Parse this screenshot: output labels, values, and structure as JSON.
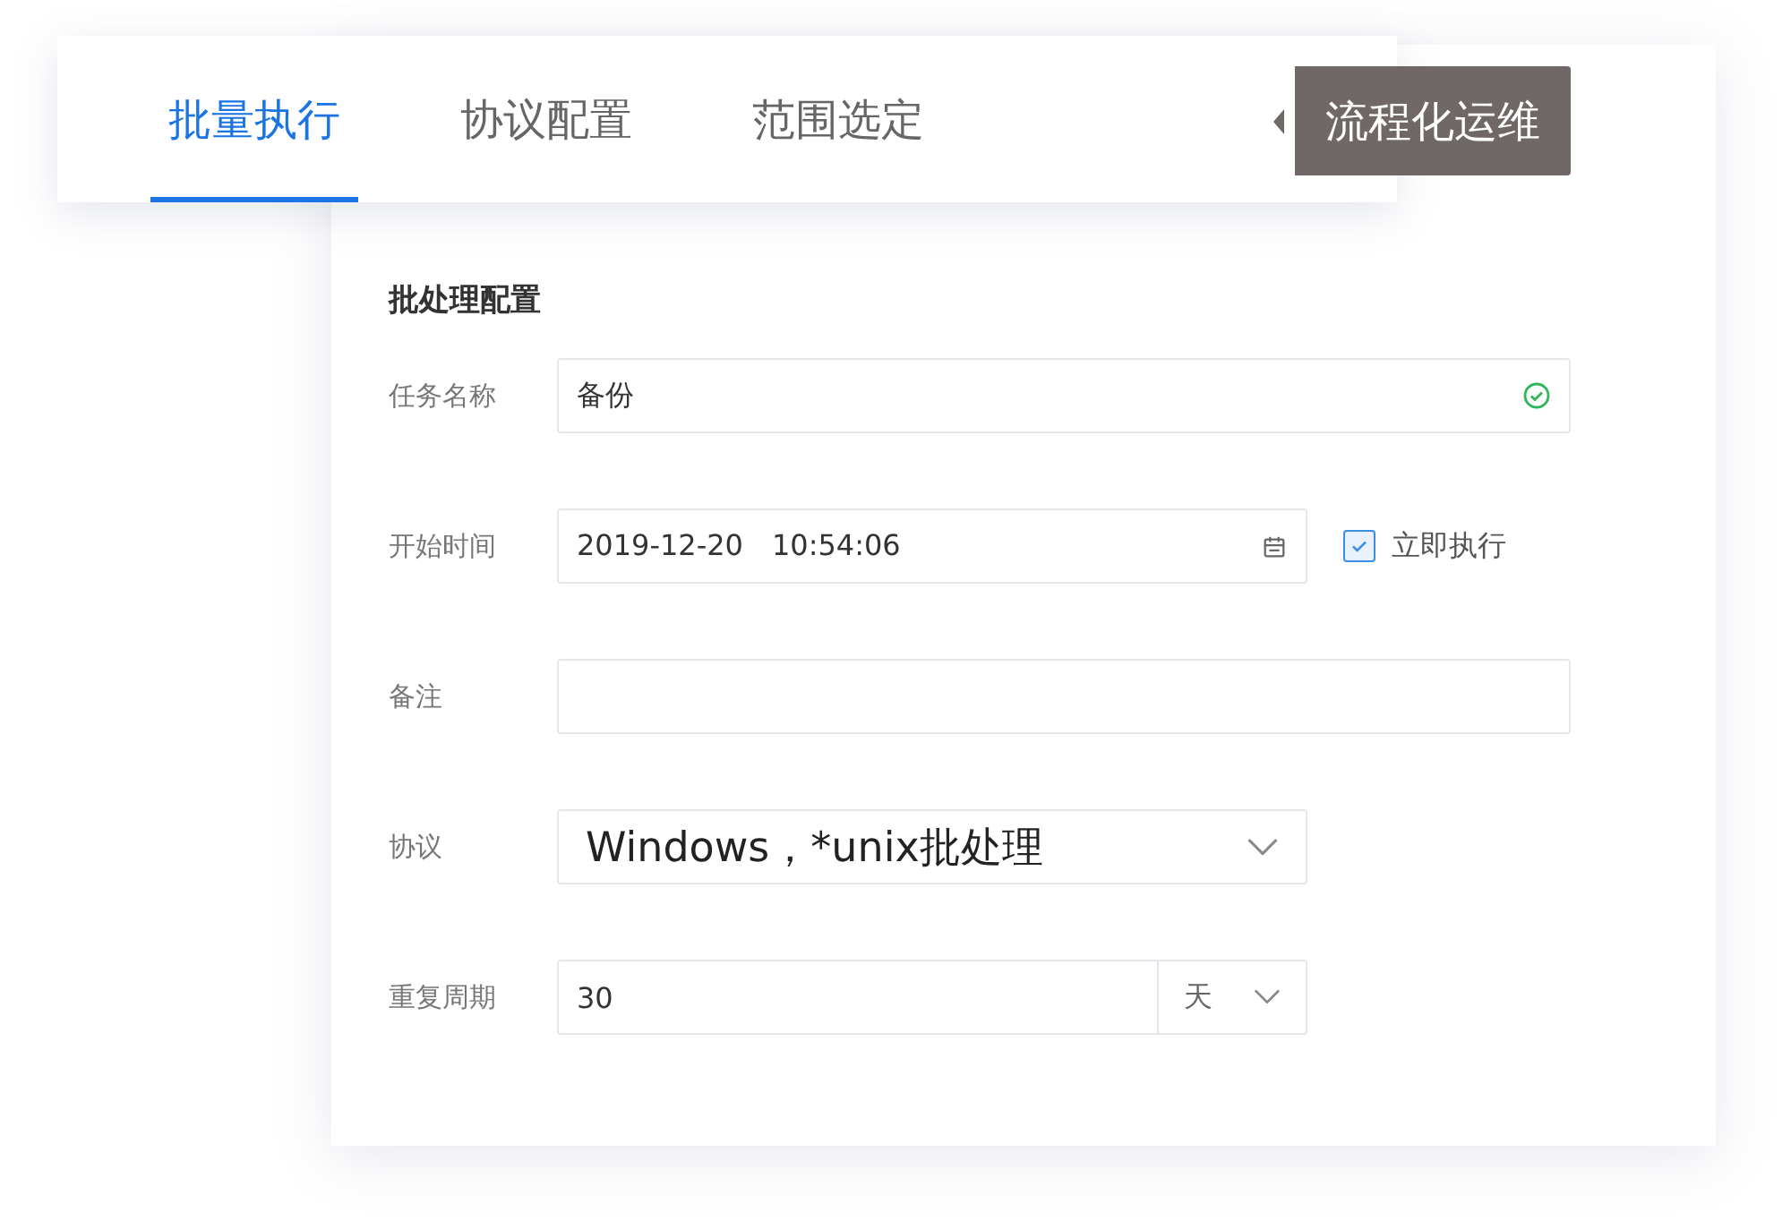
{
  "tabs": [
    {
      "label": "批量执行",
      "selected": true
    },
    {
      "label": "协议配置",
      "selected": false
    },
    {
      "label": "范围选定",
      "selected": false
    }
  ],
  "tooltip": {
    "text": "流程化运维"
  },
  "form": {
    "title": "批处理配置",
    "fields": [
      {
        "kind": "text",
        "label": "任务名称",
        "value": "备份",
        "valid": true
      },
      {
        "kind": "datetime",
        "label": "开始时间",
        "value": "2019-12-20　10:54:06",
        "checkbox": {
          "label": "立即执行",
          "checked": true
        }
      },
      {
        "kind": "text",
        "label": "备注",
        "valid": false
      },
      {
        "kind": "select",
        "label": "协议",
        "value": "Windows，*unix批处理"
      },
      {
        "kind": "number_unit",
        "label": "重复周期",
        "value": "30",
        "unit": "天"
      }
    ]
  }
}
